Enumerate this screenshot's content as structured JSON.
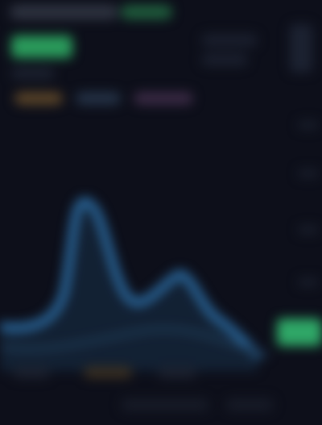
{
  "colors": {
    "background": "#0d0f1a",
    "accent_green": "#2fa767",
    "line_blue": "#2c6ea6",
    "line_dark": "#1f3a55"
  },
  "icons": [
    "sidebar-icon"
  ]
}
